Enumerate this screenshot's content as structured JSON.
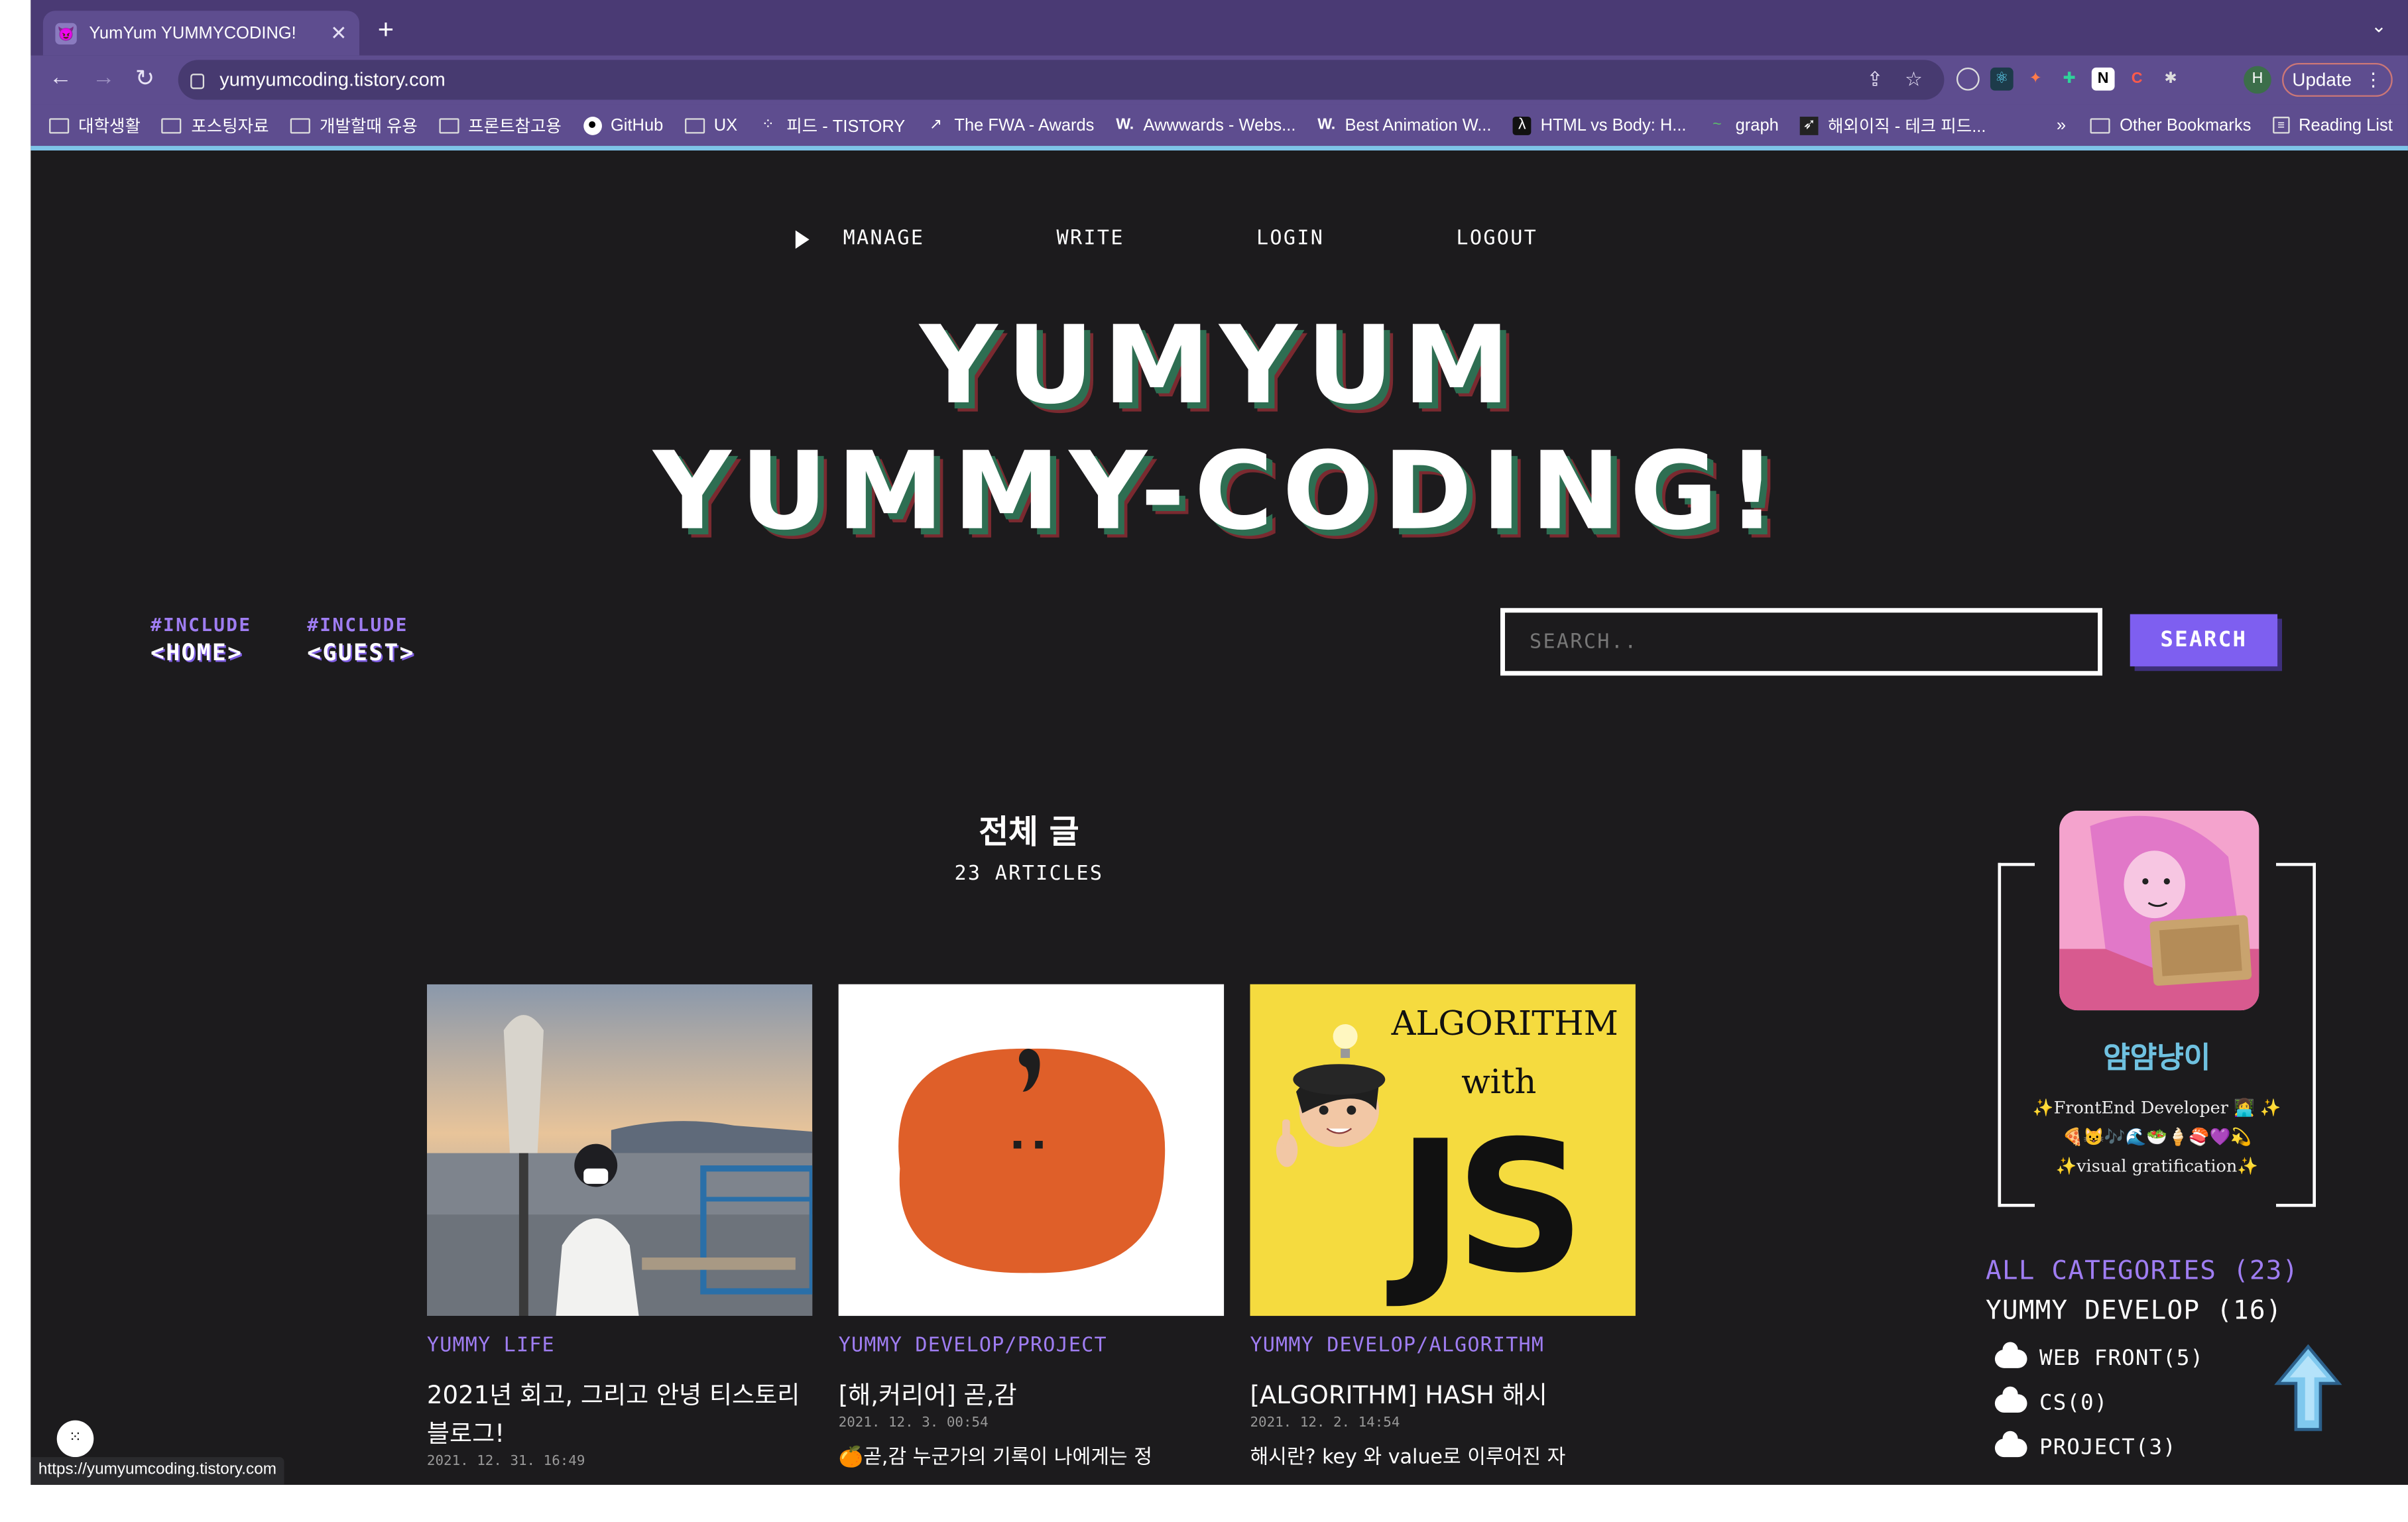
{
  "browser": {
    "tab_title": "YumYum YUMMYCODING!",
    "tab_close": "✕",
    "new_tab": "+",
    "url": "yumyumcoding.tistory.com",
    "update_label": "Update",
    "profile_initial": "H",
    "bookmarks": [
      {
        "label": "대학생활",
        "icon": "folder-icon"
      },
      {
        "label": "포스팅자료",
        "icon": "folder-icon"
      },
      {
        "label": "개발할때 유용",
        "icon": "folder-icon"
      },
      {
        "label": "프론트참고용",
        "icon": "folder-icon"
      },
      {
        "label": "GitHub",
        "icon": "github-icon"
      },
      {
        "label": "UX",
        "icon": "folder-icon"
      },
      {
        "label": "피드 - TISTORY",
        "icon": "tistory-icon"
      },
      {
        "label": "The FWA - Awards",
        "icon": "fwa-icon"
      },
      {
        "label": "Awwwards - Webs...",
        "icon": "awwwards-icon"
      },
      {
        "label": "Best Animation W...",
        "icon": "awwwards-icon"
      },
      {
        "label": "HTML vs Body: H...",
        "icon": "freecodecamp-icon"
      },
      {
        "label": "graph",
        "icon": "graph-icon"
      },
      {
        "label": "해외이직 - 테크 피드...",
        "icon": "techfeed-icon"
      }
    ],
    "bookmarks_more": "»",
    "other_bookmarks": "Other Bookmarks",
    "reading_list": "Reading List",
    "status_url": "https://yumyumcoding.tistory.com"
  },
  "nav": {
    "manage": "MANAGE",
    "write": "WRITE",
    "login": "LOGIN",
    "logout": "LOGOUT"
  },
  "hero": {
    "line1": "YUMYUM",
    "line2": "YUMMY-CODING!"
  },
  "includes": [
    {
      "directive": "#INCLUDE",
      "target": "<HOME>"
    },
    {
      "directive": "#INCLUDE",
      "target": "<GUEST>"
    }
  ],
  "search": {
    "placeholder": "SEARCH..",
    "button": "SEARCH"
  },
  "section": {
    "title": "전체 글",
    "count": "23 ARTICLES"
  },
  "articles": [
    {
      "category": "YUMMY LIFE",
      "title": "2021년 회고, 그리고 안녕 티스토리 블로그!",
      "date": "2021. 12. 31. 16:49",
      "excerpt": ""
    },
    {
      "category": "YUMMY DEVELOP/PROJECT",
      "title": "[해,커리어] 곧,감",
      "date": "2021. 12. 3. 00:54",
      "excerpt": "🍊곧,감 누군가의 기록이 나에게는 정"
    },
    {
      "category": "YUMMY DEVELOP/ALGORITHM",
      "title": "[ALGORITHM] HASH 해시",
      "date": "2021. 12. 2. 14:54",
      "excerpt": "해시란? key 와 value로 이루어진 자"
    }
  ],
  "thumb_text": {
    "algorithm": "ALGORITHM",
    "with": "with",
    "js": "JS"
  },
  "profile": {
    "name": "얌얌냥이",
    "line1": "✨FrontEnd Developer 👩‍💻 ✨",
    "line2": "🍕😺🎶🌊🥗🍦🍣💜💫",
    "line3": "✨visual gratification✨"
  },
  "categories": {
    "all": "ALL CATEGORIES (23)",
    "group": "YUMMY DEVELOP (16)",
    "items": [
      "WEB FRONT(5)",
      "CS(0)",
      "PROJECT(3)"
    ]
  },
  "colors": {
    "accent": "#7e5ff0",
    "background": "#1c1b1d",
    "chrome": "#5e4d8f"
  }
}
